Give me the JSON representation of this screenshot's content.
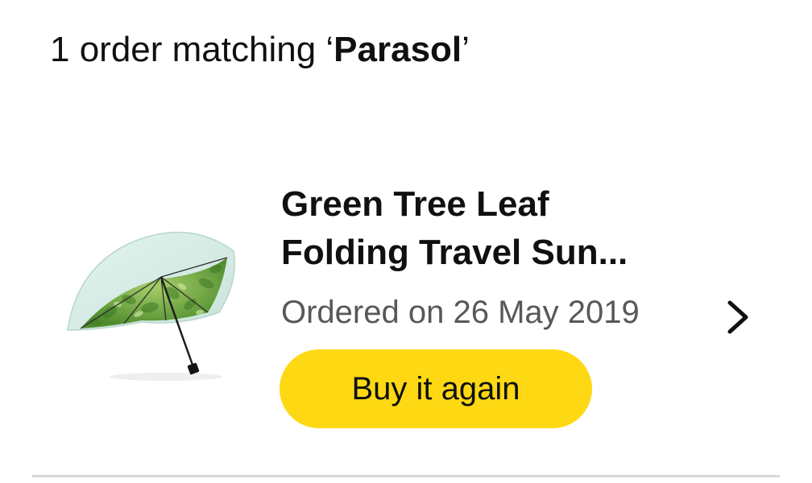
{
  "search_results": {
    "heading_prefix": "1 order matching ‘",
    "query": "Parasol",
    "heading_suffix": "’"
  },
  "orders": [
    {
      "title_line_1": "Green Tree Leaf",
      "title_line_2": "Folding Travel Sun...",
      "ordered_on": "Ordered on 26 May 2019",
      "buy_again_label": "Buy it again",
      "image_icon": "green-leaf-umbrella-image",
      "detail_icon": "chevron-right-icon"
    }
  ],
  "colors": {
    "buy_again_button": "#ffd814",
    "text_primary": "#0f1111",
    "text_secondary": "#565959",
    "divider": "#d5d9d9"
  }
}
